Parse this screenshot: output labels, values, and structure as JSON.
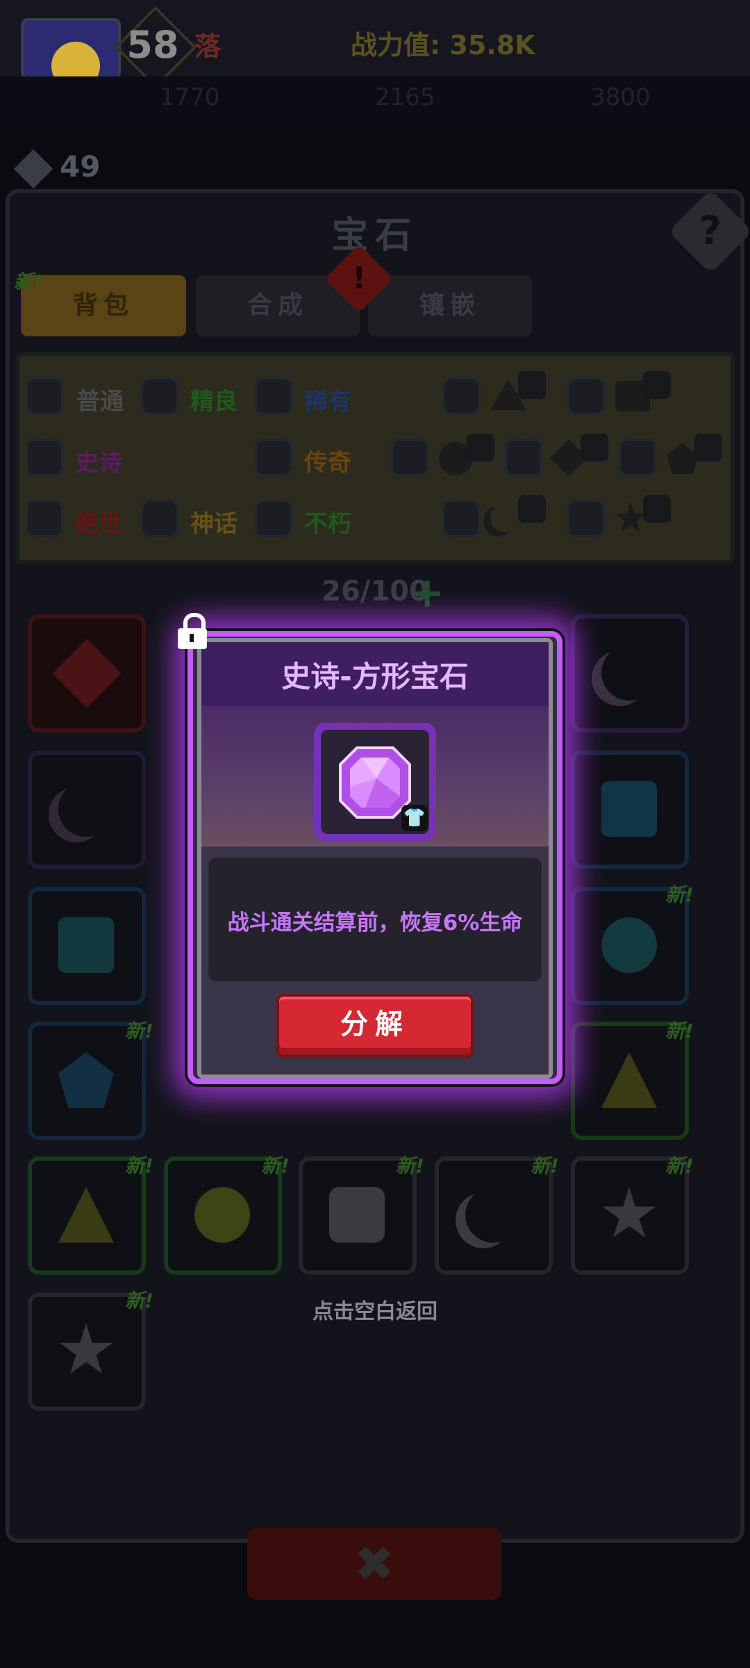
{
  "header": {
    "level": "58",
    "player_name": "落",
    "power_label": "战力值: 35.8K",
    "stats": [
      "1770",
      "2165",
      "3800"
    ]
  },
  "gem_count": "49",
  "panel": {
    "title": "宝石",
    "help": "?",
    "alert": "!",
    "tabs": [
      {
        "label": "背包",
        "new": "新!"
      },
      {
        "label": "合成"
      },
      {
        "label": "镶嵌"
      }
    ]
  },
  "filters": {
    "rarities": [
      "普通",
      "精良",
      "稀有",
      "史诗",
      "传奇",
      "绝世",
      "神话",
      "不朽"
    ],
    "colors": {
      "普通": "#4a4a4a",
      "精良": "#1f5a1c",
      "稀有": "#1d3466",
      "史诗": "#5d1a66",
      "传奇": "#6b4410",
      "绝世": "#6a1414",
      "神话": "#655216",
      "不朽": "#1f5a1c"
    }
  },
  "inventory": {
    "count": "26/100",
    "new_tag": "新!"
  },
  "back_hint": "点击空白返回",
  "modal": {
    "title": "史诗-方形宝石",
    "description": "战斗通关结算前，恢复6%生命",
    "decompose_label": "分解",
    "gem_color": "#d580ff",
    "slot_icon": "shirt-icon"
  },
  "close_icon": "✖"
}
